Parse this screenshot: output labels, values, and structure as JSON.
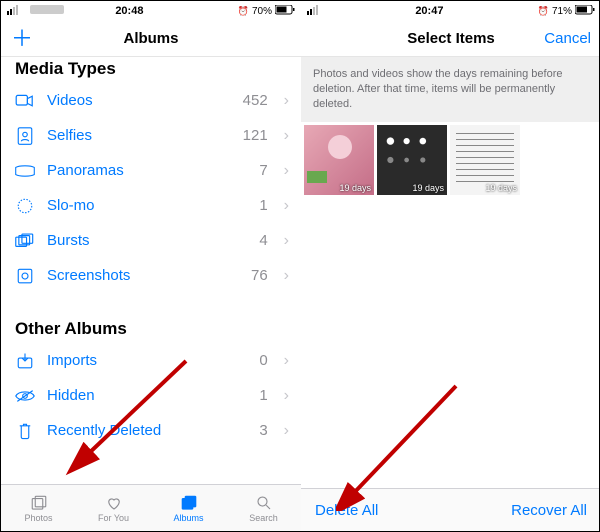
{
  "left": {
    "status": {
      "time": "20:48",
      "battery": "70%",
      "alarm": "⏰"
    },
    "nav": {
      "title": "Albums",
      "add": "＋"
    },
    "sections": [
      {
        "title": "Media Types",
        "items": [
          {
            "icon": "videos",
            "label": "Videos",
            "count": "452"
          },
          {
            "icon": "selfies",
            "label": "Selfies",
            "count": "121"
          },
          {
            "icon": "panoramas",
            "label": "Panoramas",
            "count": "7"
          },
          {
            "icon": "slomo",
            "label": "Slo-mo",
            "count": "1"
          },
          {
            "icon": "bursts",
            "label": "Bursts",
            "count": "4"
          },
          {
            "icon": "screenshots",
            "label": "Screenshots",
            "count": "76"
          }
        ]
      },
      {
        "title": "Other Albums",
        "items": [
          {
            "icon": "imports",
            "label": "Imports",
            "count": "0"
          },
          {
            "icon": "hidden",
            "label": "Hidden",
            "count": "1"
          },
          {
            "icon": "deleted",
            "label": "Recently Deleted",
            "count": "3"
          }
        ]
      }
    ],
    "tabs": [
      {
        "label": "Photos"
      },
      {
        "label": "For You"
      },
      {
        "label": "Albums"
      },
      {
        "label": "Search"
      }
    ]
  },
  "right": {
    "status": {
      "time": "20:47",
      "battery": "71%",
      "alarm": "⏰"
    },
    "nav": {
      "title": "Select Items",
      "cancel": "Cancel"
    },
    "notice": "Photos and videos show the days remaining before deletion. After that time, items will be permanently deleted.",
    "thumbs": [
      {
        "days": "19 days"
      },
      {
        "days": "19 days"
      },
      {
        "days": "19 days"
      }
    ],
    "toolbar": {
      "delete": "Delete All",
      "recover": "Recover All"
    }
  }
}
